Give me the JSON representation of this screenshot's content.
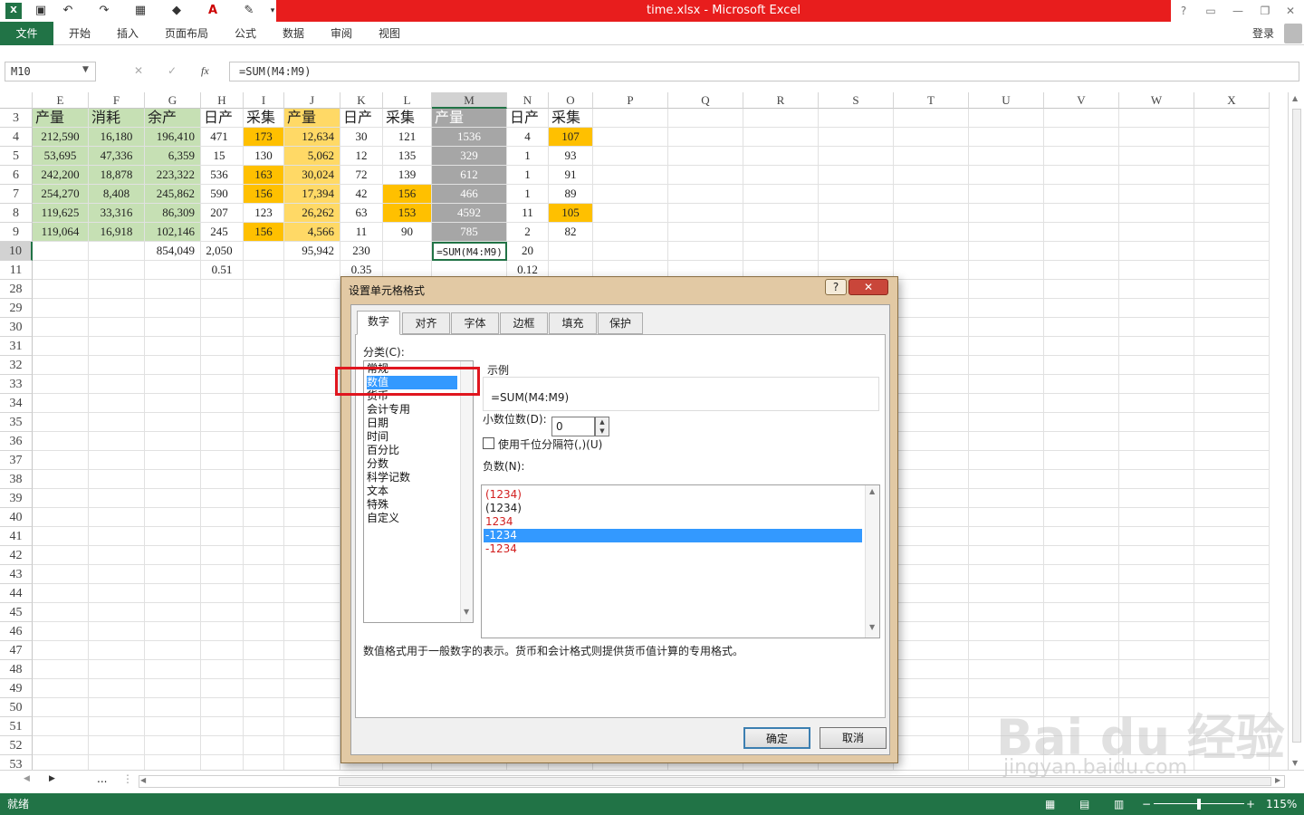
{
  "window": {
    "title": "time.xlsx -  Microsoft Excel",
    "login": "登录",
    "help": "?"
  },
  "ribbon": {
    "tabs": [
      "文件",
      "开始",
      "插入",
      "页面布局",
      "公式",
      "数据",
      "审阅",
      "视图"
    ]
  },
  "formula_bar": {
    "name_box": "M10",
    "formula": "=SUM(M4:M9)",
    "fx": "fx"
  },
  "columns": [
    "E",
    "F",
    "G",
    "H",
    "I",
    "J",
    "K",
    "L",
    "M",
    "N",
    "O",
    "P",
    "Q",
    "R",
    "S",
    "T",
    "U",
    "V",
    "W",
    "X"
  ],
  "rows": [
    {
      "num": "3",
      "cells": [
        "产量",
        "消耗",
        "余产",
        "日产",
        "采集",
        "产量",
        "日产",
        "采集",
        "产量",
        "日产",
        "采集"
      ]
    },
    {
      "num": "4",
      "cells": [
        "212,590",
        "16,180",
        "196,410",
        "471",
        "173",
        "12,634",
        "30",
        "121",
        "1536",
        "4",
        "107"
      ]
    },
    {
      "num": "5",
      "cells": [
        "53,695",
        "47,336",
        "6,359",
        "15",
        "130",
        "5,062",
        "12",
        "135",
        "329",
        "1",
        "93"
      ]
    },
    {
      "num": "6",
      "cells": [
        "242,200",
        "18,878",
        "223,322",
        "536",
        "163",
        "30,024",
        "72",
        "139",
        "612",
        "1",
        "91"
      ]
    },
    {
      "num": "7",
      "cells": [
        "254,270",
        "8,408",
        "245,862",
        "590",
        "156",
        "17,394",
        "42",
        "156",
        "466",
        "1",
        "89"
      ]
    },
    {
      "num": "8",
      "cells": [
        "119,625",
        "33,316",
        "86,309",
        "207",
        "123",
        "26,262",
        "63",
        "153",
        "4592",
        "11",
        "105"
      ]
    },
    {
      "num": "9",
      "cells": [
        "119,064",
        "16,918",
        "102,146",
        "245",
        "156",
        "4,566",
        "11",
        "90",
        "785",
        "2",
        "82"
      ]
    },
    {
      "num": "10",
      "cells": [
        "",
        "",
        "854,049",
        "2,050",
        "",
        "95,942",
        "230",
        "",
        "=SUM(M4:M9)",
        "20",
        ""
      ]
    },
    {
      "num": "11",
      "cells": [
        "",
        "",
        "",
        "0.51",
        "",
        "",
        "0.35",
        "",
        "",
        "0.12",
        ""
      ]
    }
  ],
  "extra_rows": [
    "28",
    "29",
    "30",
    "31",
    "32",
    "33",
    "34",
    "35",
    "36",
    "37",
    "38",
    "39",
    "40",
    "41",
    "42",
    "43",
    "44",
    "45",
    "46",
    "47",
    "48",
    "49",
    "50",
    "51",
    "52",
    "53"
  ],
  "dialog": {
    "title": "设置单元格格式",
    "tabs": [
      "数字",
      "对齐",
      "字体",
      "边框",
      "填充",
      "保护"
    ],
    "category_label": "分类(C):",
    "categories": [
      "常规",
      "数值",
      "货币",
      "会计专用",
      "日期",
      "时间",
      "百分比",
      "分数",
      "科学记数",
      "文本",
      "特殊",
      "自定义"
    ],
    "selected_category": "数值",
    "sample_label": "示例",
    "sample_value": "=SUM(M4:M9)",
    "decimal_label": "小数位数(D):",
    "decimal_value": "0",
    "thousands_label": "使用千位分隔符(,)(U)",
    "negative_label": "负数(N):",
    "negative_options": [
      "(1234)",
      "(1234)",
      "1234",
      "-1234",
      "-1234"
    ],
    "description": "数值格式用于一般数字的表示。货币和会计格式则提供货币值计算的专用格式。",
    "ok": "确定",
    "cancel": "取消"
  },
  "status": {
    "ready": "就绪",
    "zoom": "115%",
    "sheet_nav_more": "..."
  },
  "watermark": {
    "brand": "Bai du 经验",
    "url": "jingyan.baidu.com"
  },
  "colors": {
    "green": "#217346",
    "title_red": "#e81d1d",
    "highlight": "#e0161f",
    "cell_green": "#c6e0b4",
    "cell_orange": "#ffc000",
    "cell_lightorange": "#ffd966",
    "cell_gray": "#a6a6a6"
  }
}
